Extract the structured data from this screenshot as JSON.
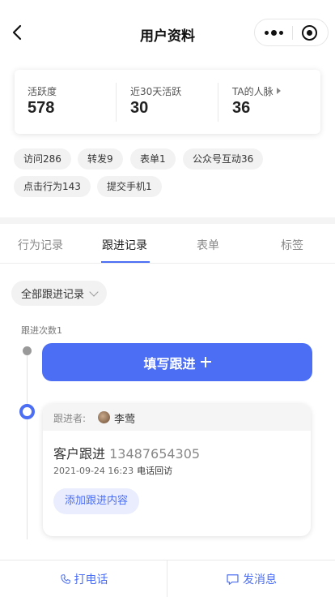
{
  "header": {
    "title": "用户资料",
    "back_icon": "chevron-left-icon",
    "more_icon": "more-dots-icon",
    "target_icon": "target-icon"
  },
  "stats": [
    {
      "label": "活跃度",
      "value": "578"
    },
    {
      "label": "近30天活跃",
      "value": "30"
    },
    {
      "label": "TA的人脉",
      "value": "36",
      "has_arrow": true
    }
  ],
  "tags": [
    "访问286",
    "转发9",
    "表单1",
    "公众号互动36",
    "点击行为143",
    "提交手机1"
  ],
  "tabs": [
    {
      "label": "行为记录",
      "active": false
    },
    {
      "label": "跟进记录",
      "active": true
    },
    {
      "label": "表单",
      "active": false
    },
    {
      "label": "标签",
      "active": false
    }
  ],
  "filter": {
    "label": "全部跟进记录"
  },
  "followup_count": "跟进次数1",
  "fill_button": "填写跟进",
  "record": {
    "follower_label": "跟进者:",
    "follower_name": "李莺",
    "title": "客户跟进",
    "phone": "13487654305",
    "datetime": "2021-09-24 16:23",
    "type": "电话回访",
    "add_button": "添加跟进内容"
  },
  "bottom": {
    "call": "打电话",
    "message": "发消息"
  },
  "colors": {
    "accent": "#4c6ef5",
    "tag_bg": "#f2f2f2"
  }
}
